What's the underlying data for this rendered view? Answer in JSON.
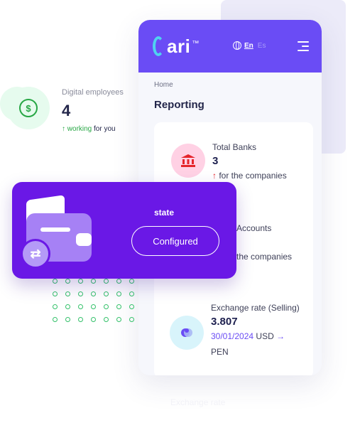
{
  "brand": {
    "name": "ari",
    "sup": "™",
    "accent": "#6a4cf5",
    "logo_color": "#4fd2f0"
  },
  "header": {
    "lang_active": "En",
    "lang_inactive": "Es"
  },
  "breadcrumb": "Home",
  "page_title": "Reporting",
  "digital": {
    "label": "Digital employees",
    "value": "4",
    "sub_green": "working",
    "sub_rest": " for you"
  },
  "stats": [
    {
      "label": "Total Banks",
      "value": "3",
      "sub": " for the companies",
      "icon": "bank-icon"
    },
    {
      "label": "Accounts",
      "sub": "the companies"
    },
    {
      "label": "Exchange rate (Selling)",
      "value": "3.807",
      "date": "30/01/2024",
      "from": "USD",
      "to": "PEN",
      "icon": "exchange-icon"
    }
  ],
  "state_card": {
    "label": "state",
    "button": "Configured",
    "color": "#6a18e6"
  },
  "ghost_text": "Exchange rate"
}
